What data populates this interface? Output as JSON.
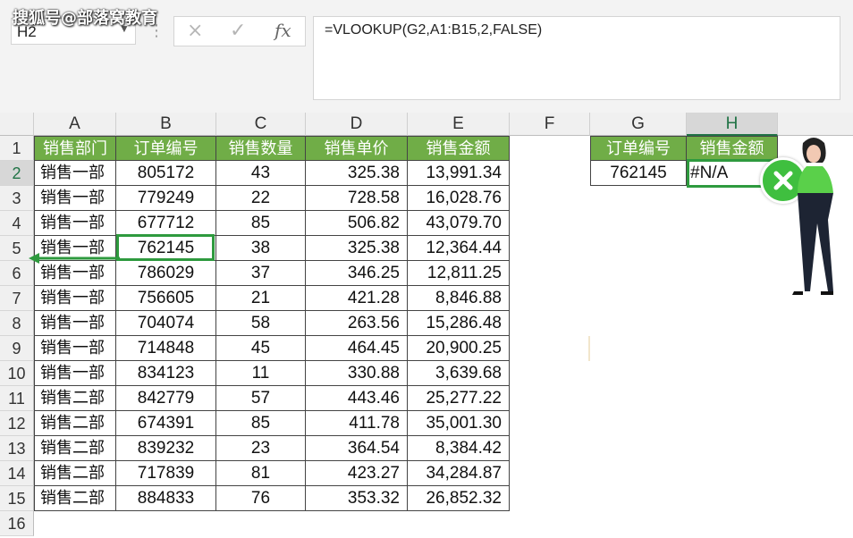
{
  "watermark": "搜狐号@部落窝教育",
  "name_box": {
    "value": "H2"
  },
  "formula_bar": {
    "cancel_glyph": "×",
    "enter_glyph": "✓",
    "fx_glyph": "fx",
    "formula": "=VLOOKUP(G2,A1:B15,2,FALSE)"
  },
  "columns": [
    "A",
    "B",
    "C",
    "D",
    "E",
    "F",
    "G",
    "H"
  ],
  "rows": [
    "1",
    "2",
    "3",
    "4",
    "5",
    "6",
    "7",
    "8",
    "9",
    "10",
    "11",
    "12",
    "13",
    "14",
    "15",
    "16"
  ],
  "table": {
    "headers": [
      "销售部门",
      "订单编号",
      "销售数量",
      "销售单价",
      "销售金额"
    ],
    "rows": [
      [
        "销售一部",
        "805172",
        "43",
        "325.38",
        "13,991.34"
      ],
      [
        "销售一部",
        "779249",
        "22",
        "728.58",
        "16,028.76"
      ],
      [
        "销售一部",
        "677712",
        "85",
        "506.82",
        "43,079.70"
      ],
      [
        "销售一部",
        "762145",
        "38",
        "325.38",
        "12,364.44"
      ],
      [
        "销售一部",
        "786029",
        "37",
        "346.25",
        "12,811.25"
      ],
      [
        "销售一部",
        "756605",
        "21",
        "421.28",
        "8,846.88"
      ],
      [
        "销售一部",
        "704074",
        "58",
        "263.56",
        "15,286.48"
      ],
      [
        "销售一部",
        "714848",
        "45",
        "464.45",
        "20,900.25"
      ],
      [
        "销售一部",
        "834123",
        "11",
        "330.88",
        "3,639.68"
      ],
      [
        "销售二部",
        "842779",
        "57",
        "443.46",
        "25,277.22"
      ],
      [
        "销售二部",
        "674391",
        "85",
        "411.78",
        "35,001.30"
      ],
      [
        "销售二部",
        "839232",
        "23",
        "364.54",
        "8,384.42"
      ],
      [
        "销售二部",
        "717839",
        "81",
        "423.27",
        "34,284.87"
      ],
      [
        "销售二部",
        "884833",
        "76",
        "353.32",
        "26,852.32"
      ]
    ]
  },
  "lookup": {
    "header_g": "订单编号",
    "header_h": "销售金额",
    "value_g": "762145",
    "value_h": "#N/A"
  },
  "error_badge_icon": "close-icon",
  "colors": {
    "header_green": "#70ad47",
    "excel_green": "#217346",
    "badge_green": "#3fbf3f"
  }
}
